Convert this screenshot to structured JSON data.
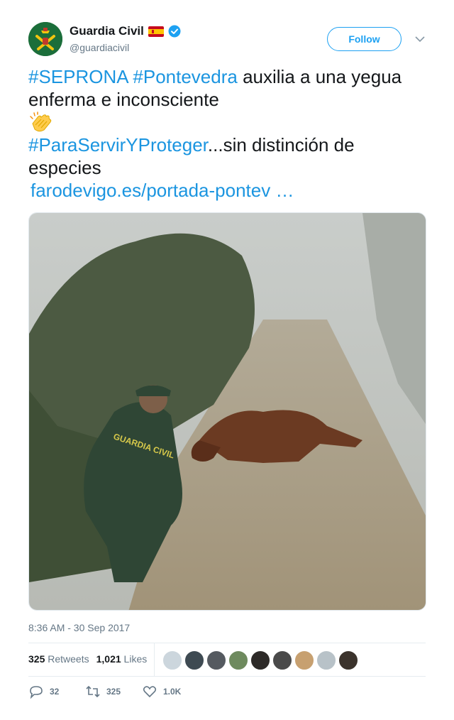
{
  "user": {
    "name": "Guardia Civil",
    "handle": "@guardiacivil",
    "follow_label": "Follow",
    "avatar_icon": "guardia-civil-emblem",
    "flag_icon": "spain-flag",
    "verified_icon": "verified-badge",
    "colors": {
      "brand": "#1b6e3a",
      "accent": "#1da1f2"
    }
  },
  "tweet": {
    "tag1": "#SEPRONA",
    "tag2": "#Pontevedra",
    "text1": " auxilia a una yegua",
    "text2": "enferma e inconsciente",
    "emoji": "clapping-hands",
    "tag3": "#ParaServirYProteger",
    "text3": "...sin distinción de",
    "text4": "especies",
    "link": "farodevigo.es/portada-pontev   …",
    "photo_text": "GUARDIA CIVIL",
    "timestamp": "8:36 AM - 30 Sep 2017"
  },
  "stats": {
    "retweets_count": "325",
    "retweets_label": "Retweets",
    "likes_count": "1,021",
    "likes_label": "Likes"
  },
  "actions": {
    "reply_count": "32",
    "retweet_count": "325",
    "like_count": "1.0K"
  }
}
